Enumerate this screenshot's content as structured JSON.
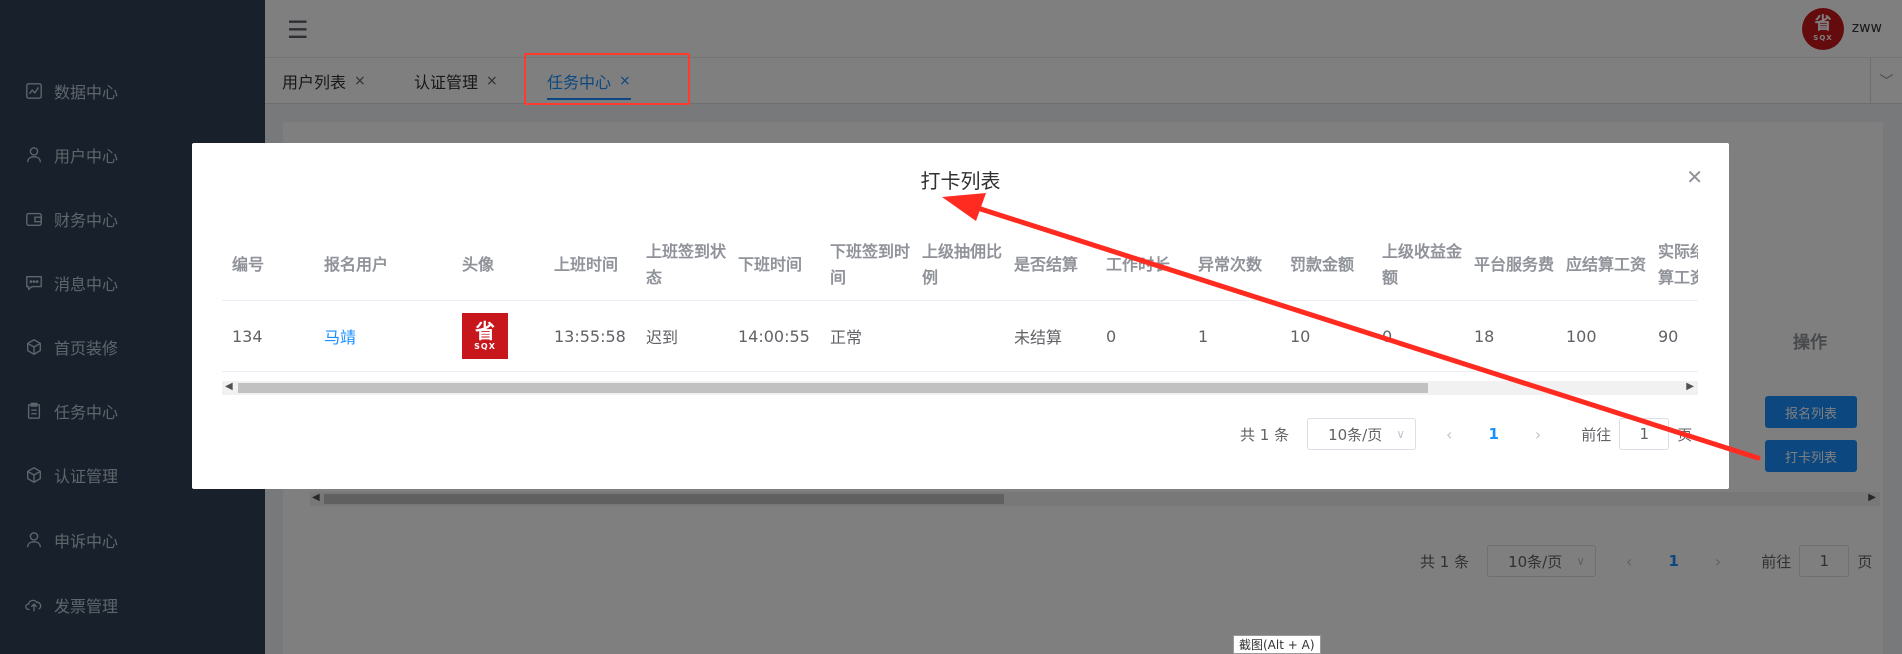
{
  "sidebar": {
    "items": [
      {
        "label": "数据中心",
        "icon": "chart-icon"
      },
      {
        "label": "用户中心",
        "icon": "user-icon"
      },
      {
        "label": "财务中心",
        "icon": "wallet-icon"
      },
      {
        "label": "消息中心",
        "icon": "message-icon"
      },
      {
        "label": "首页装修",
        "icon": "cube-icon"
      },
      {
        "label": "任务中心",
        "icon": "clipboard-icon"
      },
      {
        "label": "认证管理",
        "icon": "cube-icon"
      },
      {
        "label": "申诉中心",
        "icon": "user-icon"
      },
      {
        "label": "发票管理",
        "icon": "upload-cloud-icon"
      }
    ]
  },
  "header": {
    "menu_icon": "hamburger-icon",
    "avatar_text": "省",
    "avatar_sub": "SQX",
    "username": "zww"
  },
  "tabs": [
    {
      "label": "用户列表",
      "close": "×",
      "active": false
    },
    {
      "label": "认证管理",
      "close": "×",
      "active": false
    },
    {
      "label": "任务中心",
      "close": "×",
      "active": true
    }
  ],
  "background": {
    "op_header": "操作",
    "btn_signup_list": "报名列表",
    "btn_checkin_list": "打卡列表",
    "pager": {
      "total": "共 1 条",
      "page_size": "10条/页",
      "current": "1",
      "goto_label": "前往",
      "goto_value": "1",
      "page_suffix": "页"
    }
  },
  "modal": {
    "title": "打卡列表",
    "close_icon": "close-icon",
    "columns": [
      "编号",
      "报名用户",
      "头像",
      "上班时间",
      "上班签到状态",
      "下班时间",
      "下班签到时间",
      "上级抽佣比例",
      "是否结算",
      "工作时长",
      "异常次数",
      "罚款金额",
      "上级收益金额",
      "平台服务费",
      "应结算工资",
      "实际结算工资"
    ],
    "rows": [
      {
        "id": "134",
        "user": "马靖",
        "avatar_text": "省",
        "avatar_sub": "SQX",
        "start_time": "13:55:58",
        "start_status": "迟到",
        "end_time": "14:00:55",
        "end_status": "正常",
        "commission_ratio": "",
        "settled": "未结算",
        "work_hours": "0",
        "abnormal_count": "1",
        "fine": "10",
        "superior_income": "0",
        "platform_fee": "18",
        "payable_wage": "100",
        "actual_wage": "90"
      }
    ],
    "pager": {
      "total": "共 1 条",
      "page_size": "10条/页",
      "current": "1",
      "goto_label": "前往",
      "goto_value": "1",
      "page_suffix": "页"
    }
  },
  "screenshot_tooltip": "截图(Alt + A)",
  "colors": {
    "accent": "#1890ff",
    "sidebar": "#304156",
    "annotation": "#ff3b30"
  }
}
